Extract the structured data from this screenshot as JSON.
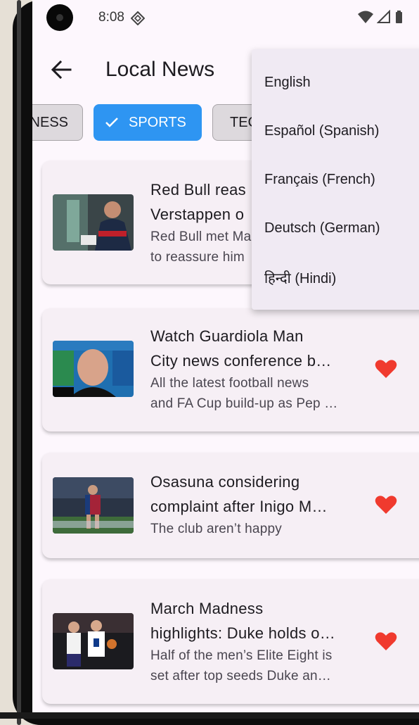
{
  "status_bar": {
    "time": "8:08"
  },
  "app_bar": {
    "title": "Local News"
  },
  "categories": [
    {
      "label": "NESS",
      "selected": false
    },
    {
      "label": "SPORTS",
      "selected": true
    },
    {
      "label": "TEC",
      "selected": false
    }
  ],
  "articles": [
    {
      "title_lines": [
        "Red Bull reas",
        "Verstappen o"
      ],
      "desc_lines": [
        "Red Bull met Ma",
        "to reassure him"
      ],
      "favorited": false
    },
    {
      "title_lines": [
        "Watch Guardiola Man",
        "City news conference b…"
      ],
      "desc_lines": [
        "All the latest football news",
        "and FA Cup build-up as Pep …"
      ],
      "favorited": true
    },
    {
      "title_lines": [
        "Osasuna considering",
        "complaint after Inigo M…"
      ],
      "desc_lines": [
        "The club aren’t happy"
      ],
      "favorited": true
    },
    {
      "title_lines": [
        "March Madness",
        "highlights: Duke holds o…"
      ],
      "desc_lines": [
        "Half of the men’s Elite Eight is",
        "set after top seeds Duke an…"
      ],
      "favorited": true
    }
  ],
  "language_menu": {
    "items": [
      "English",
      "Español (Spanish)",
      "Français (French)",
      "Deutsch (German)",
      "हिन्दी (Hindi)"
    ]
  },
  "colors": {
    "accent": "#2e95f2",
    "heart": "#f03a2e",
    "background": "#fdf7fd",
    "card": "#f6eff5",
    "menu": "#f0eaf3"
  }
}
